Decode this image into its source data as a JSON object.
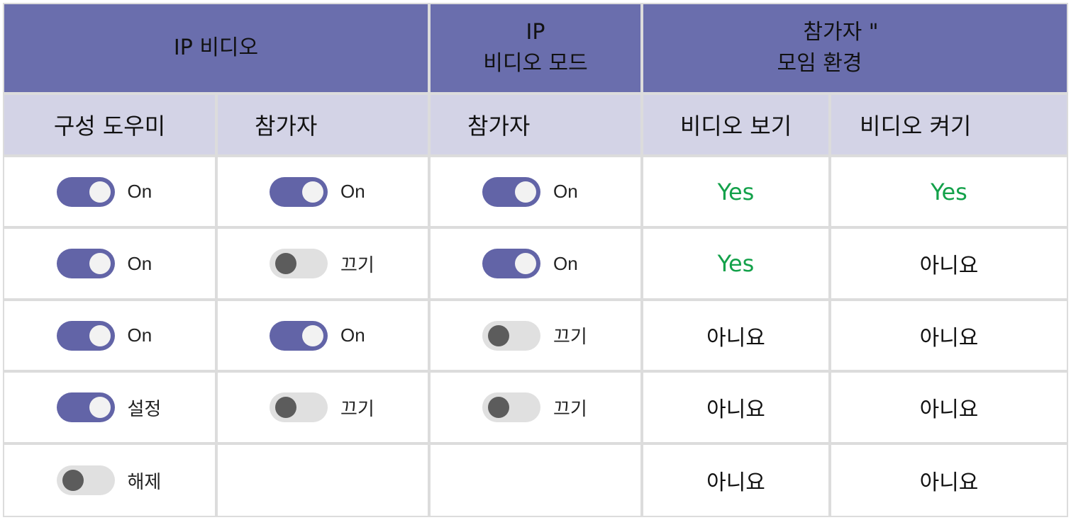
{
  "header_groups": [
    {
      "label": "IP 비디오"
    },
    {
      "label_line1": "IP",
      "label_line2": "비디오 모드"
    },
    {
      "label_line1": "참가자 \"",
      "label_line2": "모임 환경"
    }
  ],
  "columns": [
    {
      "label": "구성 도우미"
    },
    {
      "label": "참가자"
    },
    {
      "label": "참가자"
    },
    {
      "label": "비디오 보기"
    },
    {
      "label": "비디오 켜기"
    }
  ],
  "colors": {
    "header_dark": "#6a6ead",
    "header_light": "#d3d3e6",
    "toggle_on": "#6264a7",
    "yes_green": "#13a14a"
  },
  "rows": [
    {
      "organizer": {
        "state": "on",
        "label": "On"
      },
      "participant": {
        "state": "on",
        "label": "On"
      },
      "mode": {
        "state": "on",
        "label": "On"
      },
      "see_video": "Yes",
      "turn_on_video": "Yes"
    },
    {
      "organizer": {
        "state": "on",
        "label": "On"
      },
      "participant": {
        "state": "off",
        "label": "끄기"
      },
      "mode": {
        "state": "on",
        "label": "On"
      },
      "see_video": "Yes",
      "turn_on_video": "아니요"
    },
    {
      "organizer": {
        "state": "on",
        "label": "On"
      },
      "participant": {
        "state": "on",
        "label": "On"
      },
      "mode": {
        "state": "off",
        "label": "끄기"
      },
      "see_video": "아니요",
      "turn_on_video": "아니요"
    },
    {
      "organizer": {
        "state": "on",
        "label": "설정"
      },
      "participant": {
        "state": "off",
        "label": "끄기"
      },
      "mode": {
        "state": "off",
        "label": "끄기"
      },
      "see_video": "아니요",
      "turn_on_video": "아니요"
    },
    {
      "organizer": {
        "state": "off",
        "label": "해제"
      },
      "participant": null,
      "mode": null,
      "see_video": "아니요",
      "turn_on_video": "아니요"
    }
  ]
}
